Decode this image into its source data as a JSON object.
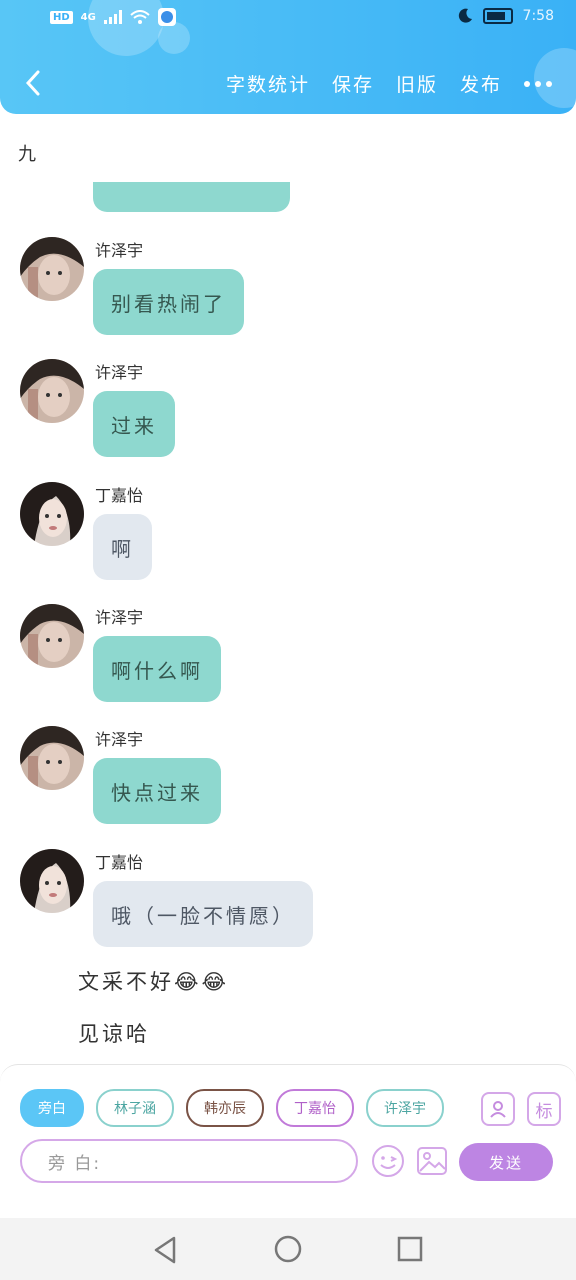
{
  "status_bar": {
    "hd": "HD",
    "network": "4G",
    "time": "7:58"
  },
  "header": {
    "actions": [
      "字数统计",
      "保存",
      "旧版",
      "发布"
    ]
  },
  "chapter_title": "九",
  "messages": [
    {
      "name": "许泽宇",
      "text": "别看热闹了",
      "style": "green",
      "avatar": "male"
    },
    {
      "name": "许泽宇",
      "text": "过来",
      "style": "green",
      "avatar": "male"
    },
    {
      "name": "丁嘉怡",
      "text": "啊",
      "style": "gray",
      "avatar": "female"
    },
    {
      "name": "许泽宇",
      "text": "啊什么啊",
      "style": "green",
      "avatar": "male"
    },
    {
      "name": "许泽宇",
      "text": "快点过来",
      "style": "green",
      "avatar": "male"
    },
    {
      "name": "丁嘉怡",
      "text": "哦（一脸不情愿）",
      "style": "gray",
      "avatar": "female"
    }
  ],
  "narration": [
    "文采不好😂😂",
    "见谅哈"
  ],
  "composer": {
    "chips": [
      "旁白",
      "林子涵",
      "韩亦辰",
      "丁嘉怡",
      "许泽宇"
    ],
    "mark_button": "标",
    "input_placeholder": "旁 白:",
    "send_label": "发送"
  },
  "colors": {
    "header": "#3ab1f6",
    "bubble_green": "#8ed8cf",
    "bubble_gray": "#e2e8ef",
    "send": "#bd85e3"
  }
}
